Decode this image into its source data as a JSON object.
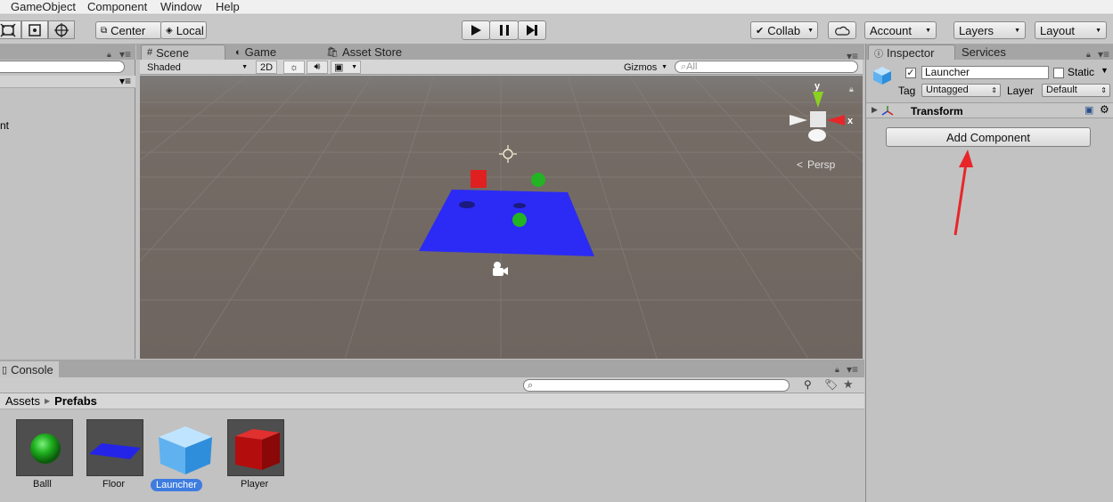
{
  "menu": [
    "GameObject",
    "Component",
    "Window",
    "Help"
  ],
  "toolbar": {
    "pivot_center": "Center",
    "pivot_local": "Local",
    "collab": "Collab",
    "account": "Account",
    "layers": "Layers",
    "layout": "Layout"
  },
  "hierarchy": {
    "partial_item": "nt"
  },
  "scene": {
    "tabs": [
      "Scene",
      "Game",
      "Asset Store"
    ],
    "draw_mode": "Shaded",
    "mode_2d": "2D",
    "gizmos": "Gizmos",
    "search_placeholder": "All",
    "persp": "Persp",
    "gizmo_y": "y",
    "gizmo_x": "x"
  },
  "console": {
    "tab": "Console"
  },
  "project": {
    "breadcrumb_root": "Assets",
    "breadcrumb_current": "Prefabs",
    "assets": [
      {
        "name": "Balll",
        "selected": false
      },
      {
        "name": "Floor",
        "selected": false
      },
      {
        "name": "Launcher",
        "selected": true
      },
      {
        "name": "Player",
        "selected": false
      }
    ]
  },
  "inspector": {
    "tabs": [
      "Inspector",
      "Services"
    ],
    "object_name": "Launcher",
    "static_label": "Static",
    "tag_label": "Tag",
    "tag_value": "Untagged",
    "layer_label": "Layer",
    "layer_value": "Default",
    "transform_label": "Transform",
    "add_component": "Add Component"
  },
  "colors": {
    "accent": "#3e7ce0",
    "annotation_arrow": "#e8262a",
    "floor_blue": "#2b2bf5",
    "player_red": "#e02020",
    "ball_green": "#22b422"
  }
}
